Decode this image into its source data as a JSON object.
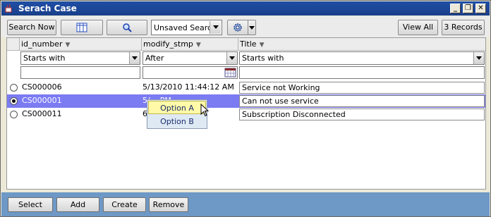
{
  "window": {
    "title": "Serach Case",
    "controls": [
      "minimize",
      "restore",
      "close"
    ]
  },
  "toolbar": {
    "search_now": "Search Now",
    "columns_icon": "table-columns-icon",
    "search_icon": "magnifier-icon",
    "saved_search": "Unsaved Search",
    "settings_icon": "gear-icon",
    "view_all": "View All",
    "records": "3 Records"
  },
  "columns": [
    {
      "label": "id_number",
      "filter": "Starts with",
      "filter_value": ""
    },
    {
      "label": "modify_stmp",
      "filter": "After",
      "filter_value": ""
    },
    {
      "label": "Title",
      "filter": "Starts with",
      "filter_value": ""
    }
  ],
  "rows": [
    {
      "selected": false,
      "id": "CS000006",
      "modified": "5/13/2010 11:44:12 AM",
      "title": "Service not Working"
    },
    {
      "selected": true,
      "id": "CS000001",
      "modified": "5/... PM",
      "title": "Can not use service"
    },
    {
      "selected": false,
      "id": "CS000011",
      "modified": "6... M",
      "title": "Subscription Disconnected"
    }
  ],
  "popup": {
    "items": [
      "Option A",
      "Option B"
    ],
    "highlighted": "Option A"
  },
  "bottom": {
    "select": "Select",
    "add": "Add",
    "create": "Create",
    "remove": "Remove"
  },
  "colors": {
    "titlebar": "#1f4fa6",
    "selected_row": "#7b7bf2",
    "bottom_bar": "#6e98c6"
  }
}
